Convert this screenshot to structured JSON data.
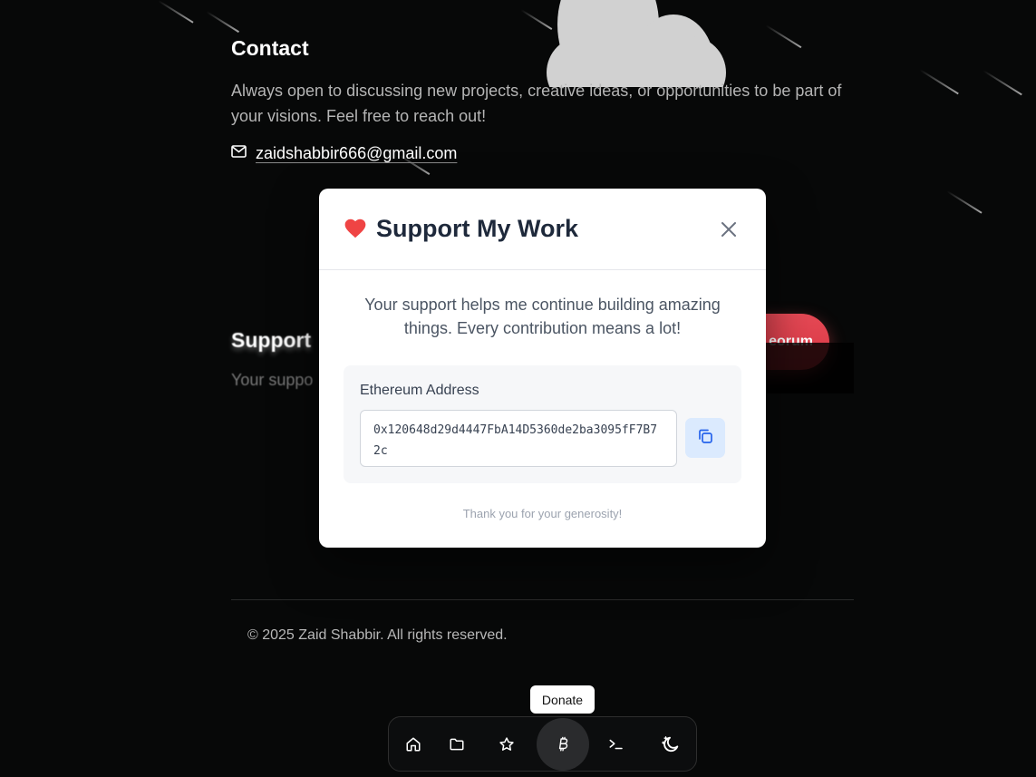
{
  "contact": {
    "title": "Contact",
    "text": "Always open to discussing new projects, creative ideas, or opportunities to be part of your visions. Feel free to reach out!",
    "email": "zaidshabbir666@gmail.com"
  },
  "support_section": {
    "title": "Support",
    "text": "Your suppo",
    "button_label": "eorum"
  },
  "modal": {
    "title": "Support My Work",
    "description": "Your support helps me continue building amazing things. Every contribution means a lot!",
    "address_label": "Ethereum Address",
    "address": "0x120648d29d4447FbA14D5360de2ba3095fF7B72c",
    "thanks": "Thank you for your generosity!"
  },
  "footer": {
    "copyright": "© 2025 Zaid Shabbir. All rights reserved."
  },
  "dock": {
    "tooltip": "Donate",
    "items": [
      {
        "icon": "home-icon",
        "label": "Home"
      },
      {
        "icon": "folder-icon",
        "label": "Projects"
      },
      {
        "icon": "star-icon",
        "label": "Favorites"
      },
      {
        "icon": "bitcoin-icon",
        "label": "Donate",
        "active": true
      },
      {
        "icon": "terminal-icon",
        "label": "Terminal"
      },
      {
        "icon": "moon-icon",
        "label": "Theme"
      }
    ]
  },
  "colors": {
    "background": "#070808",
    "accent_red": "#e64955",
    "heart": "#ef4444",
    "copy_button": "#dbeafe",
    "copy_icon": "#2563eb"
  }
}
